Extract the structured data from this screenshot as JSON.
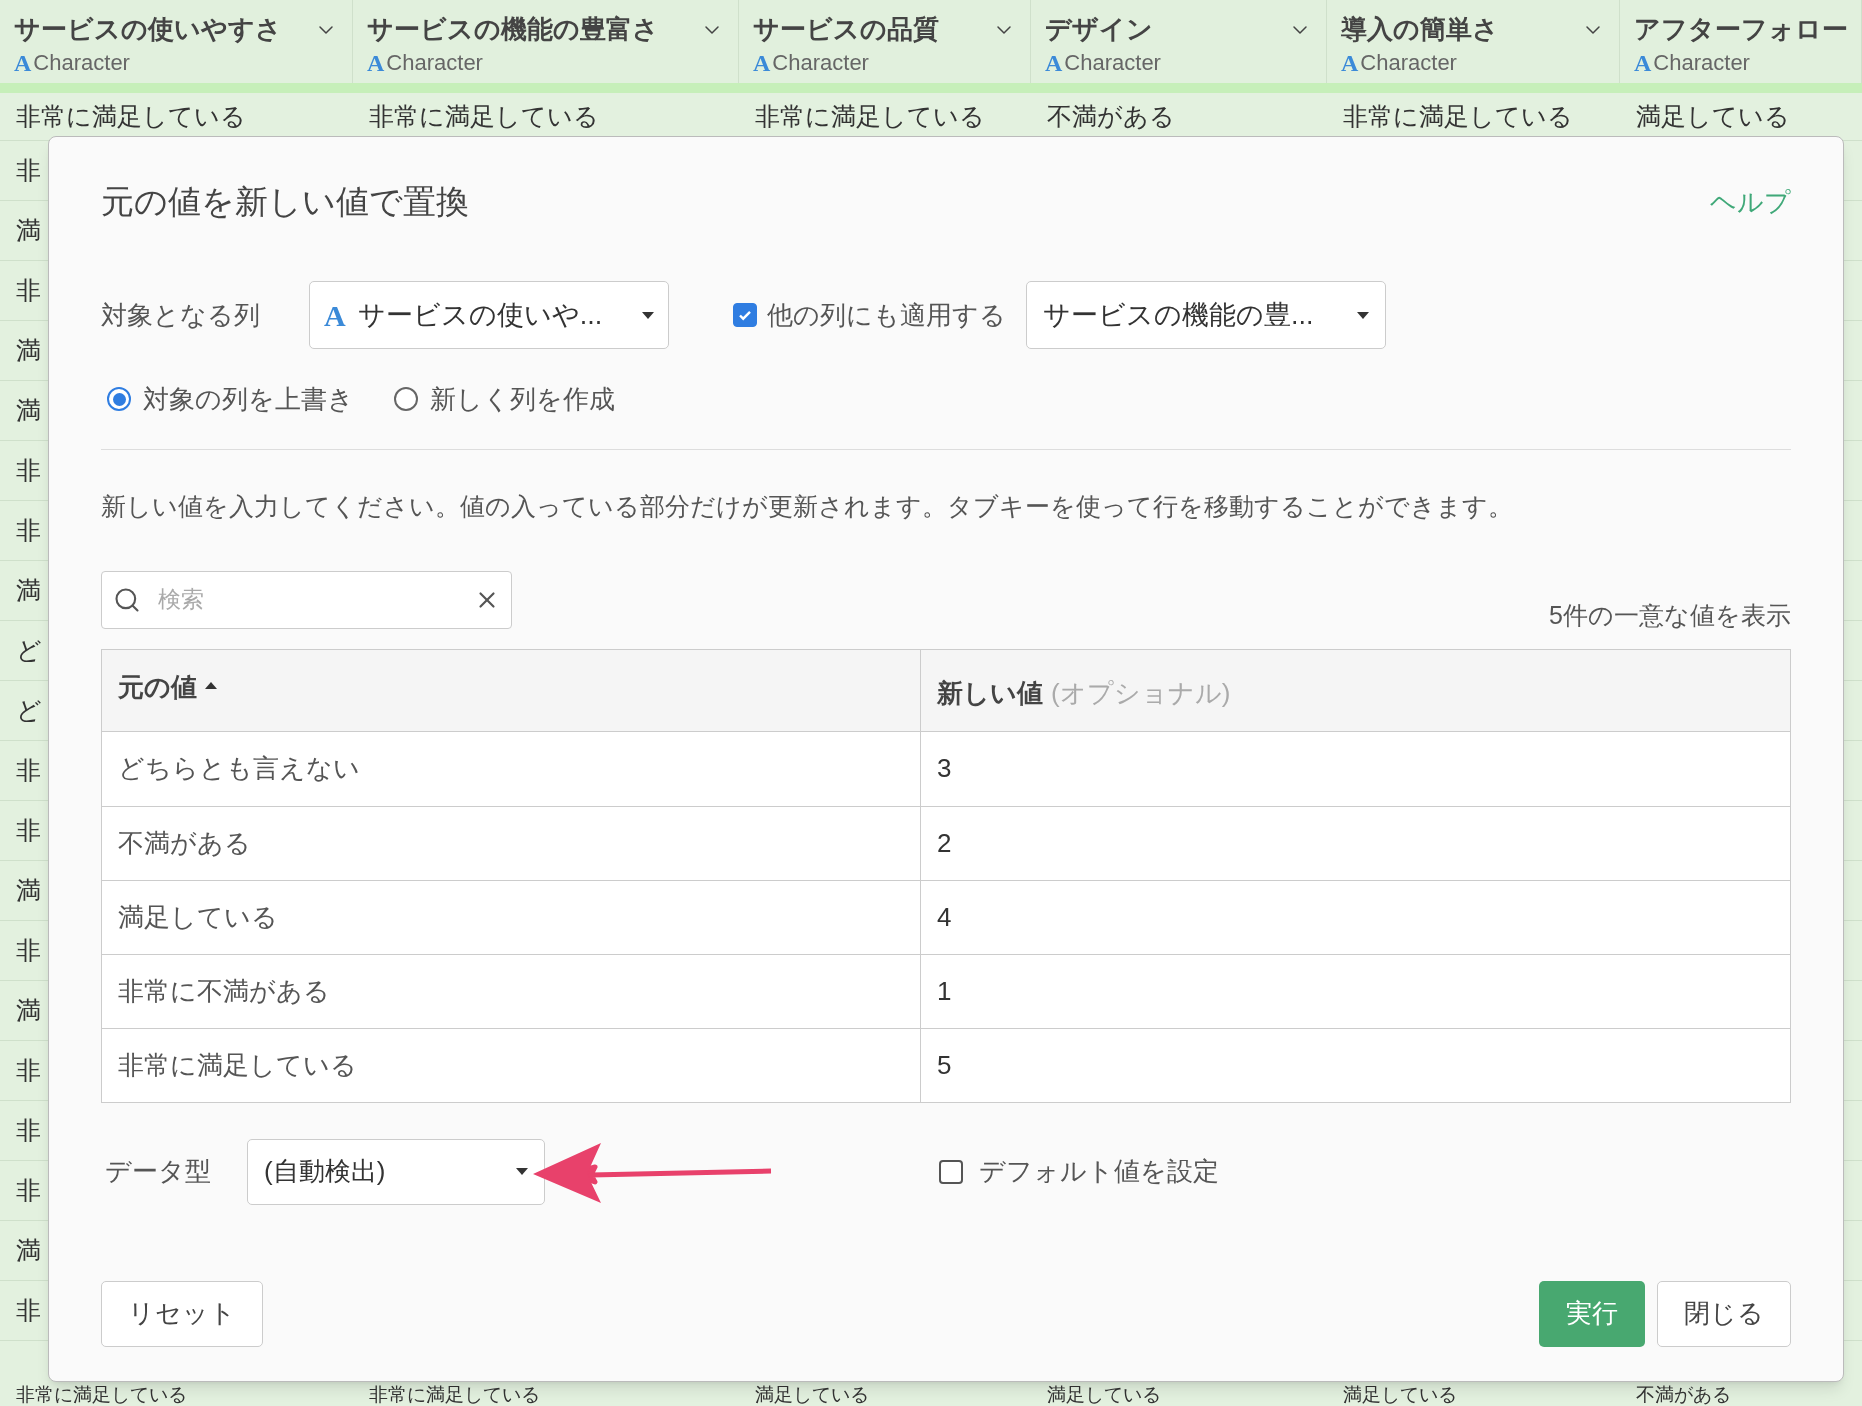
{
  "grid": {
    "columns": [
      {
        "name": "サービスの使いやすさ",
        "type_mark": "A",
        "type": "Character"
      },
      {
        "name": "サービスの機能の豊富さ",
        "type_mark": "A",
        "type": "Character"
      },
      {
        "name": "サービスの品質",
        "type_mark": "A",
        "type": "Character"
      },
      {
        "name": "デザイン",
        "type_mark": "A",
        "type": "Character"
      },
      {
        "name": "導入の簡単さ",
        "type_mark": "A",
        "type": "Character"
      },
      {
        "name": "アフターフォロー",
        "type_mark": "A",
        "type": "Character"
      }
    ],
    "first_row": [
      "非常に満足している",
      "非常に満足している",
      "非常に満足している",
      "不満がある",
      "非常に満足している",
      "満足している"
    ],
    "column_1_visible": [
      "非",
      "満",
      "非",
      "満",
      "満",
      "非",
      "非",
      "満",
      "ど",
      "ど",
      "非",
      "非",
      "満",
      "非",
      "満",
      "非",
      "非",
      "非",
      "満",
      "非"
    ],
    "last_row": [
      "非常に満足している",
      "非常に満足している",
      "満足している",
      "満足している",
      "満足している",
      "不満がある"
    ]
  },
  "dialog": {
    "title": "元の値を新しい値で置換",
    "help": "ヘルプ",
    "target_label": "対象となる列",
    "target_type_mark": "A",
    "target_column": "サービスの使いや...",
    "apply_other": {
      "label": "他の列にも適用する",
      "checked": true
    },
    "other_column": "サービスの機能の豊...",
    "modes": [
      {
        "label": "対象の列を上書き",
        "selected": true
      },
      {
        "label": "新しく列を作成",
        "selected": false
      }
    ],
    "instruction": "新しい値を入力してください。値の入っている部分だけが更新されます。タブキーを使って行を移動することができます。",
    "search": {
      "placeholder": "検索"
    },
    "count": "5件の一意な値を表示",
    "table": {
      "columns": [
        {
          "label": "元の値",
          "sorted": true
        },
        {
          "label": "新しい値",
          "note": "(オプショナル)",
          "sorted": false
        }
      ],
      "rows": [
        {
          "original": "どちらとも言えない",
          "new": "3"
        },
        {
          "original": "不満がある",
          "new": "2"
        },
        {
          "original": "満足している",
          "new": "4"
        },
        {
          "original": "非常に不満がある",
          "new": "1"
        },
        {
          "original": "非常に満足している",
          "new": "5"
        }
      ]
    },
    "data_type": {
      "label": "データ型",
      "value": "(自動検出)"
    },
    "default_value": {
      "label": "デフォルト値を設定",
      "checked": false
    },
    "buttons": {
      "reset": "リセット",
      "run": "実行",
      "close": "閉じる"
    }
  }
}
